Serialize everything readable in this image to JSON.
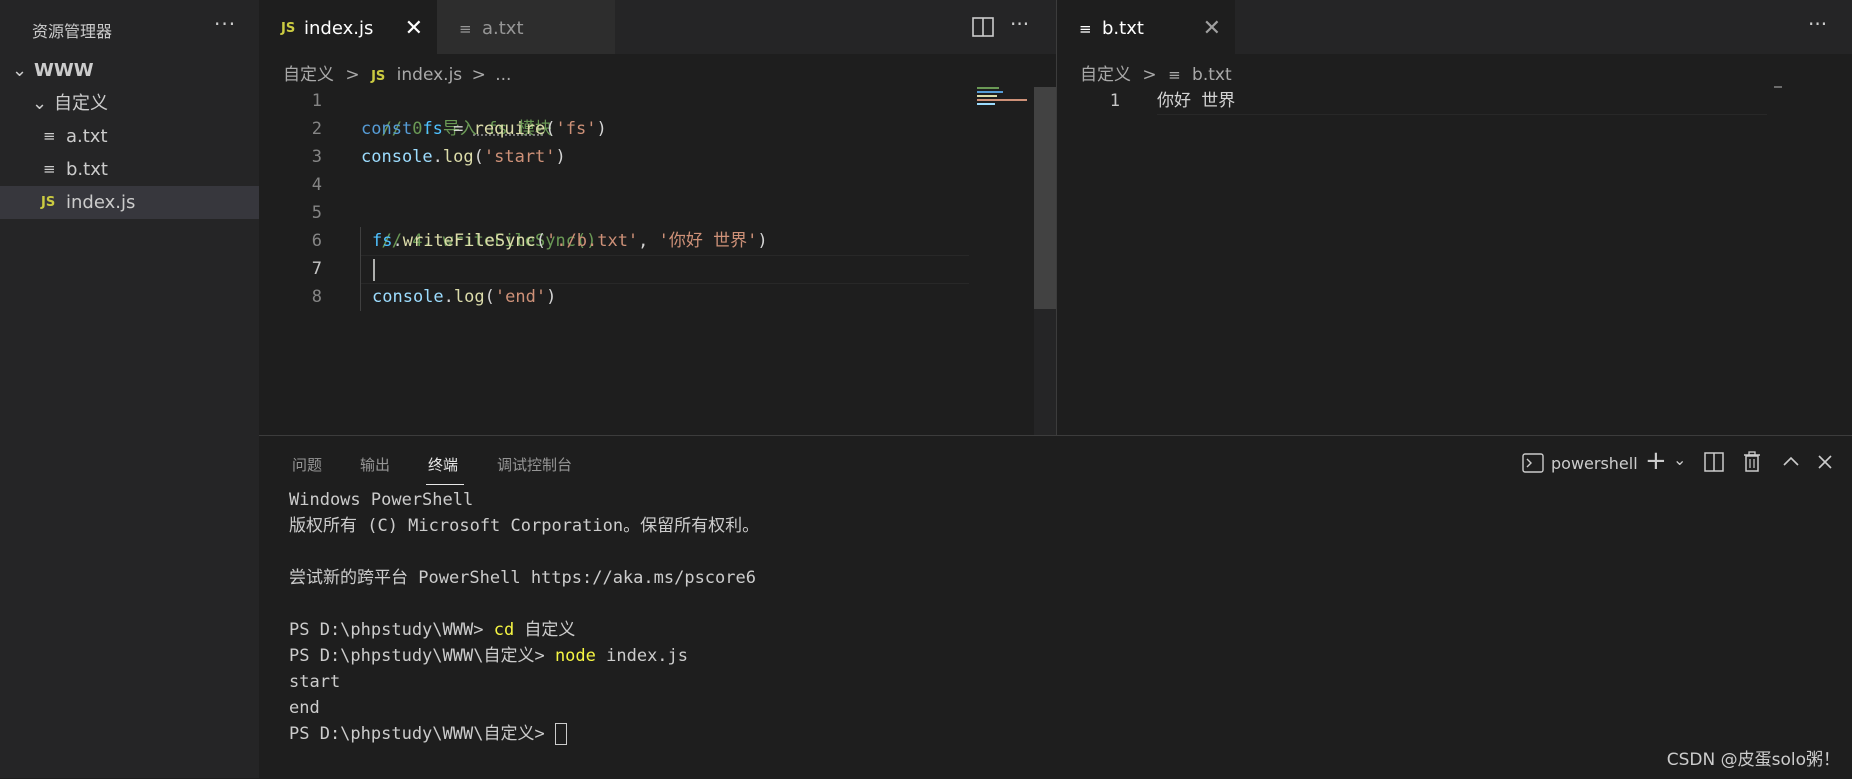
{
  "sidebar": {
    "title": "资源管理器",
    "more": "···",
    "tree": [
      {
        "label": "WWW",
        "kind": "folder-root"
      },
      {
        "label": "自定义",
        "kind": "folder"
      },
      {
        "label": "a.txt",
        "kind": "txt"
      },
      {
        "label": "b.txt",
        "kind": "txt"
      },
      {
        "label": "index.js",
        "kind": "js",
        "selected": true
      }
    ]
  },
  "editor1": {
    "tabs": [
      {
        "label": "index.js",
        "icon": "JS",
        "active": true,
        "close": "✕"
      },
      {
        "label": "a.txt",
        "icon": "≡",
        "active": false
      }
    ],
    "breadcrumb": {
      "folder": "自定义",
      "sep": ">",
      "file_icon": "JS",
      "file": "index.js",
      "tail": "..."
    },
    "line_numbers": [
      "1",
      "2",
      "3",
      "4",
      "5",
      "6",
      "7",
      "8"
    ],
    "code": {
      "l1_comment": "// 0. 导入 fs 模块",
      "l2_kw": "const",
      "l2_var": "fs",
      "l2_eq": " = ",
      "l2_fn": "require",
      "l2_open": "(",
      "l2_str": "'fs'",
      "l2_close": ")",
      "l3_obj": "console",
      "l3_dot": ".",
      "l3_fn": "log",
      "l3_open": "(",
      "l3_str": "'start'",
      "l3_close": ")",
      "l5_comment": "// 4. writeFileSync()",
      "l6_obj": "fs",
      "l6_dot": ".",
      "l6_fn": "writeFileSync",
      "l6_open": "(",
      "l6_str1": "'./b.txt'",
      "l6_comma": ", ",
      "l6_str2": "'你好 世界'",
      "l6_close": ")",
      "l8_obj": "console",
      "l8_dot": ".",
      "l8_fn": "log",
      "l8_open": "(",
      "l8_str": "'end'",
      "l8_close": ")"
    }
  },
  "editor2": {
    "tabs": [
      {
        "label": "b.txt",
        "icon": "≡",
        "close": "✕"
      }
    ],
    "breadcrumb": {
      "folder": "自定义",
      "sep": ">",
      "file_icon": "≡",
      "file": "b.txt"
    },
    "line_numbers": [
      "1"
    ],
    "content": "你好 世界"
  },
  "panel": {
    "tabs": [
      "问题",
      "输出",
      "终端",
      "调试控制台"
    ],
    "active_tab": "终端",
    "shell": "powershell",
    "terminal": [
      {
        "text": "Windows PowerShell"
      },
      {
        "text": "版权所有 (C) Microsoft Corporation。保留所有权利。"
      },
      {
        "text": ""
      },
      {
        "text": "尝试新的跨平台 PowerShell https://aka.ms/pscore6"
      },
      {
        "text": ""
      },
      {
        "prompt": "PS D:\\phpstudy\\WWW> ",
        "cmd": "cd",
        "arg": " 自定义"
      },
      {
        "prompt": "PS D:\\phpstudy\\WWW\\自定义> ",
        "cmd": "node",
        "arg": " index.js"
      },
      {
        "text": "start"
      },
      {
        "text": "end"
      },
      {
        "prompt": "PS D:\\phpstudy\\WWW\\自定义> "
      }
    ]
  },
  "watermark": "CSDN @皮蛋solo粥！"
}
